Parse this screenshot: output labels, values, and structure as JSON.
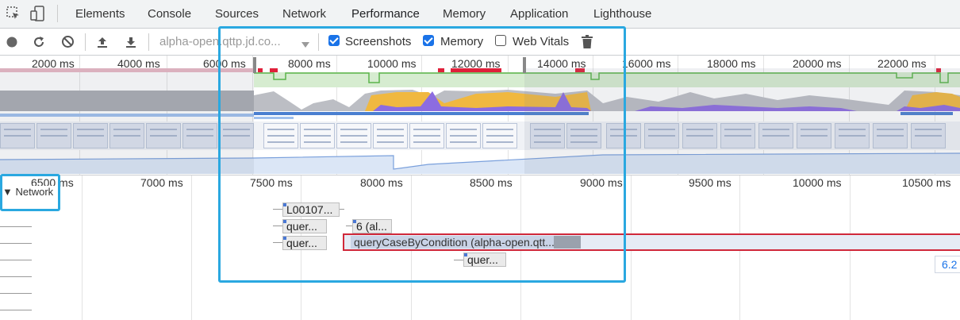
{
  "tabs": [
    "Elements",
    "Console",
    "Sources",
    "Network",
    "Performance",
    "Memory",
    "Application",
    "Lighthouse"
  ],
  "toolbar": {
    "url_select": "alpha-open.qttp.jd.co...",
    "screenshots_label": "Screenshots",
    "memory_label": "Memory",
    "web_vitals_label": "Web Vitals",
    "screenshots_checked": true,
    "memory_checked": true,
    "web_vitals_checked": false
  },
  "overview": {
    "ticks": [
      "2000 ms",
      "4000 ms",
      "6000 ms",
      "8000 ms",
      "10000 ms",
      "12000 ms",
      "14000 ms",
      "16000 ms",
      "18000 ms",
      "20000 ms",
      "22000 ms"
    ]
  },
  "flamechart": {
    "ticks": [
      "6500 ms",
      "7000 ms",
      "7500 ms",
      "8000 ms",
      "8500 ms",
      "9000 ms",
      "9500 ms",
      "10000 ms",
      "10500 ms"
    ],
    "network_label": "Network",
    "requests": {
      "r1": "L00107...",
      "r2": "quer...",
      "r3": "6 (al...",
      "r4": "quer...",
      "r5": "queryCaseByCondition (alpha-open.qtt...",
      "r6": "quer..."
    },
    "tooltip_value": "6.2"
  },
  "colors": {
    "accent": "#1a73e8",
    "highlight": "#2aa8e0",
    "fps_green": "#c8e6c0",
    "cpu_yellow": "#f0b840",
    "cpu_purple": "#8c6ce0",
    "selected_request_border": "#d0283a"
  },
  "icons": [
    "inspect-icon",
    "device-icon",
    "record-icon",
    "reload-icon",
    "clear-icon",
    "upload-icon",
    "download-icon",
    "trash-icon",
    "caret-down-icon"
  ]
}
